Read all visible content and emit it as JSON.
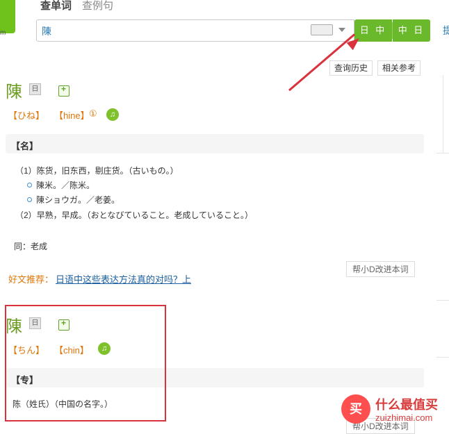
{
  "header": {
    "logo_text": "m",
    "tabs": [
      "查单词",
      "查例句"
    ],
    "search_value": "陳",
    "lang_buttons": [
      "日 中",
      "中 日"
    ],
    "edge_text": "提"
  },
  "toolbar": {
    "history_label": "查询历史",
    "related_label": "相关参考"
  },
  "entry1": {
    "word": "陳",
    "badge": "日",
    "kana": "【ひね】",
    "romaji": "【hine】",
    "accent": "①",
    "pos": "【名】",
    "defs": {
      "d1": "（1）陈货，旧东西，剔庄货。（古いもの。）",
      "ex1": "陳米。／陈米。",
      "ex2": "陳ショウガ。／老姜。",
      "d2": "（2）早熟，早成。（おとなびていること。老成していること。）"
    },
    "synonym": "同：老成",
    "help_label": "帮小D改进本词"
  },
  "recommend": {
    "label": "好文推荐：",
    "link": "日语中这些表达方法真的对吗？上"
  },
  "entry2": {
    "word": "陳",
    "badge": "日",
    "kana": "【ちん】",
    "romaji": "【chin】",
    "pos": "【专】",
    "def": "陈（姓氏）（中国の名字。）",
    "help_label": "帮小D改进本词"
  },
  "watermark": {
    "icon_text": "买",
    "title": "什么最值买",
    "url": "zuizhimai.com"
  }
}
